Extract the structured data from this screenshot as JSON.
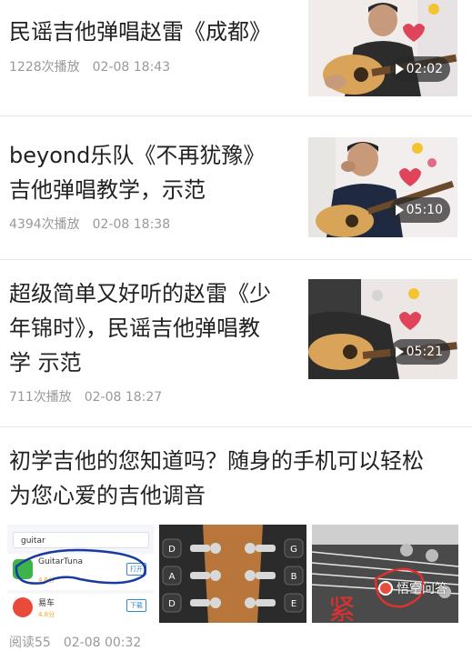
{
  "feed": {
    "items": [
      {
        "title_lines": [
          "民谣吉他弹唱赵雷《成都》"
        ],
        "views": "1228次播放",
        "date": "02-08 18:43",
        "duration": "02:02"
      },
      {
        "title_lines": [
          "beyond乐队《不再犹豫》",
          "吉他弹唱教学，示范"
        ],
        "views": "4394次播放",
        "date": "02-08 18:38",
        "duration": "05:10"
      },
      {
        "title_lines": [
          "超级简单又好听的赵雷《少",
          "年锦时》，民谣吉他弹唱教",
          "学 示范"
        ],
        "views": "711次播放",
        "date": "02-08 18:27",
        "duration": "05:21"
      }
    ],
    "article": {
      "title_lines": [
        "初学吉他的您知道吗？随身的手机可以轻松",
        "为您心爱的吉他调音"
      ],
      "reads": "阅读55",
      "date": "02-08 00:32",
      "images": {
        "app_list": {
          "search_text": "guitar",
          "app1_name": "GuitarTuna",
          "app1_button": "打开",
          "app2_name": "易车",
          "app2_button": "下载",
          "rating1": "4.6分",
          "rating2": "4.8分"
        },
        "tuner_notes_left": [
          "D",
          "A",
          "D"
        ],
        "tuner_notes_right": [
          "G",
          "B",
          "E"
        ]
      },
      "watermark": "悟空问答"
    }
  }
}
